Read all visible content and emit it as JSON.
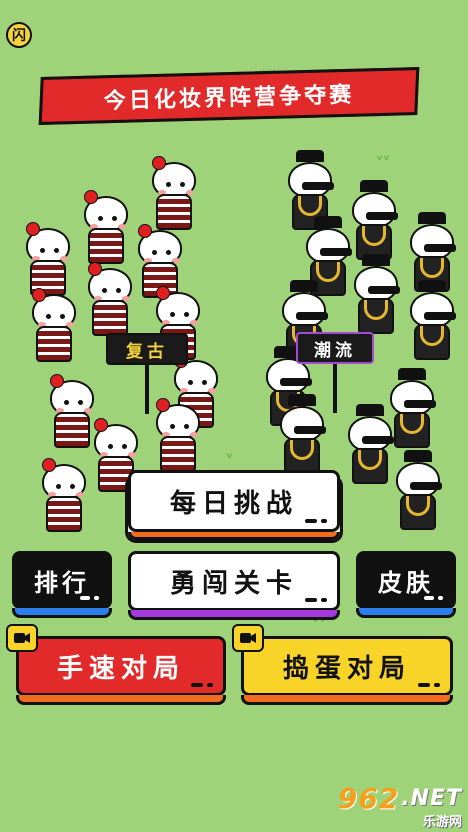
{
  "top_icon": "闪",
  "title": "今日化妆界阵营争夺赛",
  "factions": {
    "retro": "复古",
    "trendy": "潮流"
  },
  "buttons": {
    "daily": "每日挑战",
    "rank": "排行",
    "level": "勇闯关卡",
    "skin": "皮肤",
    "fast": "手速对局",
    "prank": "捣蛋对局"
  },
  "watermark": {
    "brand": "962",
    "suffix": ".NET",
    "sub": "乐游网"
  },
  "colors": {
    "background": "#9ed37a",
    "banner": "#e22a2a",
    "daily_strip": "#f26b1f",
    "rank_strip": "#2d7dea",
    "level_strip": "#a63adf",
    "fast": "#e22a2a",
    "prank": "#f9d428"
  },
  "icons": [
    "lightning-icon",
    "video-ad-icon"
  ]
}
